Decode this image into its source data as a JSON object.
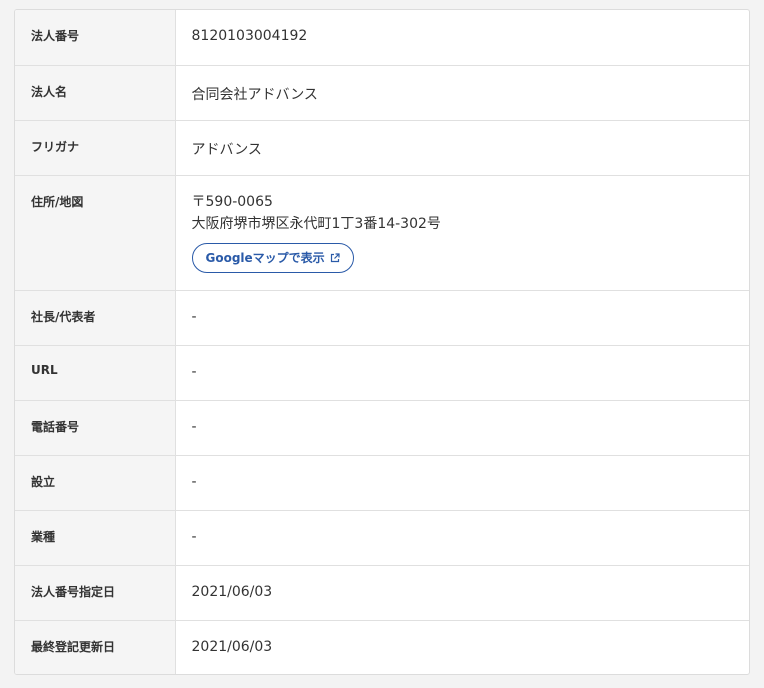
{
  "rows": [
    {
      "label": "法人番号",
      "value": "8120103004192"
    },
    {
      "label": "法人名",
      "value": "合同会社アドバンス"
    },
    {
      "label": "フリガナ",
      "value": "アドバンス"
    },
    {
      "label": "住所/地図",
      "postal": "〒590-0065",
      "address": "大阪府堺市堺区永代町1丁3番14-302号",
      "map_button": "Googleマップで表示"
    },
    {
      "label": "社長/代表者",
      "value": "-"
    },
    {
      "label": "URL",
      "value": "-"
    },
    {
      "label": "電話番号",
      "value": "-"
    },
    {
      "label": "設立",
      "value": "-"
    },
    {
      "label": "業種",
      "value": "-"
    },
    {
      "label": "法人番号指定日",
      "value": "2021/06/03"
    },
    {
      "label": "最終登記更新日",
      "value": "2021/06/03"
    }
  ],
  "icons": {
    "map_button_icon": "external-link-icon"
  },
  "colors": {
    "accent": "#2a5aa8",
    "label_bg": "#f5f5f5",
    "border": "#e0e0e0"
  }
}
